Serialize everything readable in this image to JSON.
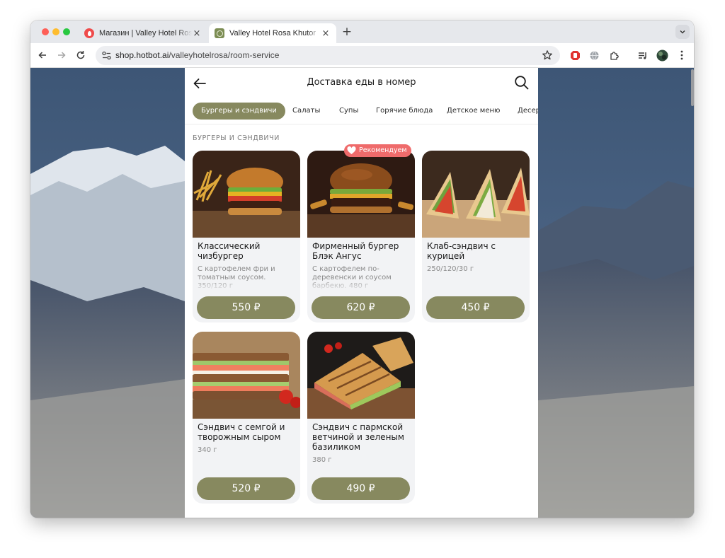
{
  "browser": {
    "tabs": [
      {
        "title": "Магазин | Valley Hotel Rosa K",
        "active": false
      },
      {
        "title": "Valley Hotel Rosa Khutor",
        "active": true
      }
    ],
    "url_host": "shop.hotbot.ai",
    "url_path": "/valleyhotelrosa/room-service"
  },
  "app": {
    "title": "Доставка еды в номер",
    "categories": [
      "Бургеры и сэндвичи",
      "Салаты",
      "Супы",
      "Горячие блюда",
      "Детское меню",
      "Десерты"
    ],
    "active_category": "Бургеры и сэндвичи",
    "section_title": "БУРГЕРЫ И СЭНДВИЧИ",
    "badge": "Рекомендуем",
    "items": [
      {
        "name": "Классический чизбургер",
        "desc": "С картофелем фри и томатным соусом. 350/120 г",
        "price": "550 ₽"
      },
      {
        "name": "Фирменный бургер Блэк Ангус",
        "desc": "С картофелем по-деревенски и соусом барбекю. 480 г",
        "price": "620 ₽"
      },
      {
        "name": "Клаб-сэндвич с курицей",
        "desc": "250/120/30 г",
        "price": "450 ₽"
      },
      {
        "name": "Сэндвич с семгой и творожным сыром",
        "desc": "340 г",
        "price": "520 ₽"
      },
      {
        "name": "Сэндвич с пармской ветчиной и зеленым базиликом",
        "desc": "380 г",
        "price": "490 ₽"
      }
    ]
  },
  "colors": {
    "accent": "#87895f",
    "badge": "#ef6b6b",
    "card_bg": "#f2f3f5"
  },
  "icons": [
    "back-arrow-icon",
    "forward-arrow-icon",
    "reload-icon",
    "site-info-icon",
    "bookmark-star-icon",
    "search-icon",
    "heart-icon",
    "extension-icon",
    "profile-avatar-icon"
  ]
}
